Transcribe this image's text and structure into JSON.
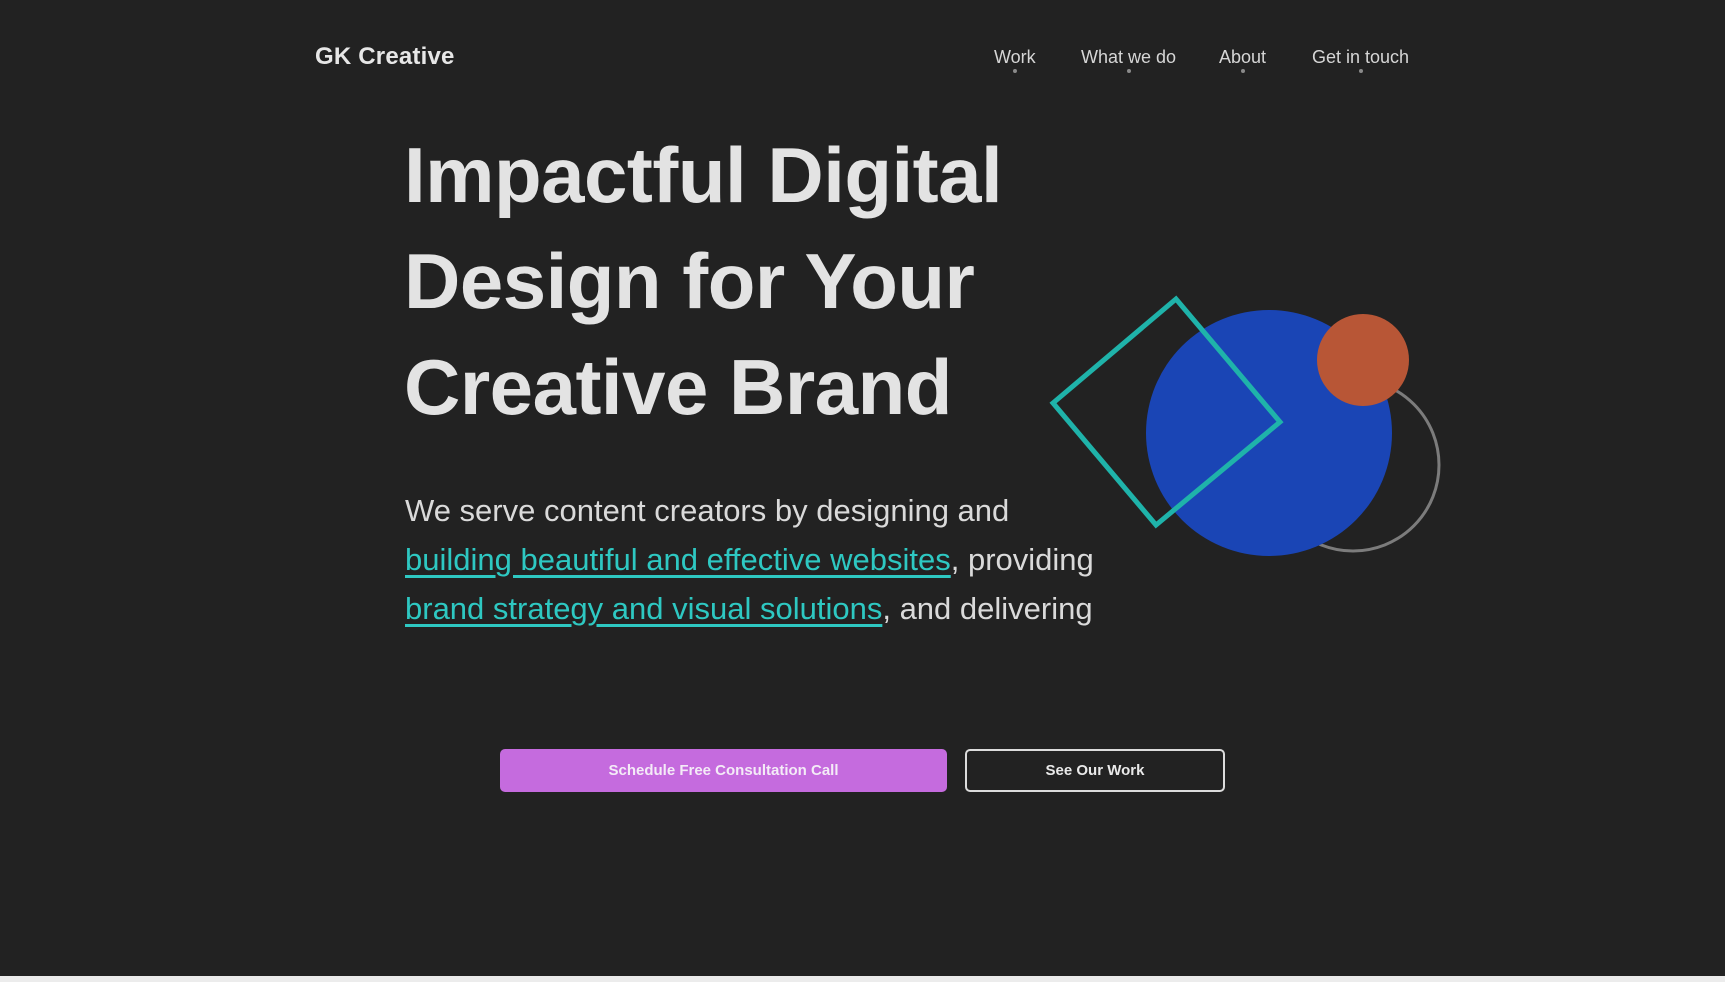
{
  "header": {
    "logo": "GK Creative",
    "nav": [
      {
        "label": "Work"
      },
      {
        "label": "What we do"
      },
      {
        "label": "About"
      },
      {
        "label": "Get in touch"
      }
    ]
  },
  "hero": {
    "title_lines": [
      "Impactful Digital",
      "Design for Your",
      "Creative Brand"
    ],
    "subtitle": {
      "part1": "We serve content creators by designing and",
      "link1": "building beautiful and effective websites",
      "part2": ", providing",
      "link2": "brand strategy and visual solutions",
      "part3": ", and delivering"
    }
  },
  "buttons": {
    "primary": "Schedule Free Consultation Call",
    "secondary": "See Our Work"
  },
  "colors": {
    "background": "#222222",
    "accent_teal": "#2ec8c2",
    "accent_purple": "#c56bde",
    "shape_blue": "#1a45b5",
    "shape_orange": "#b85636",
    "ring_gray": "#7c7c7c"
  }
}
